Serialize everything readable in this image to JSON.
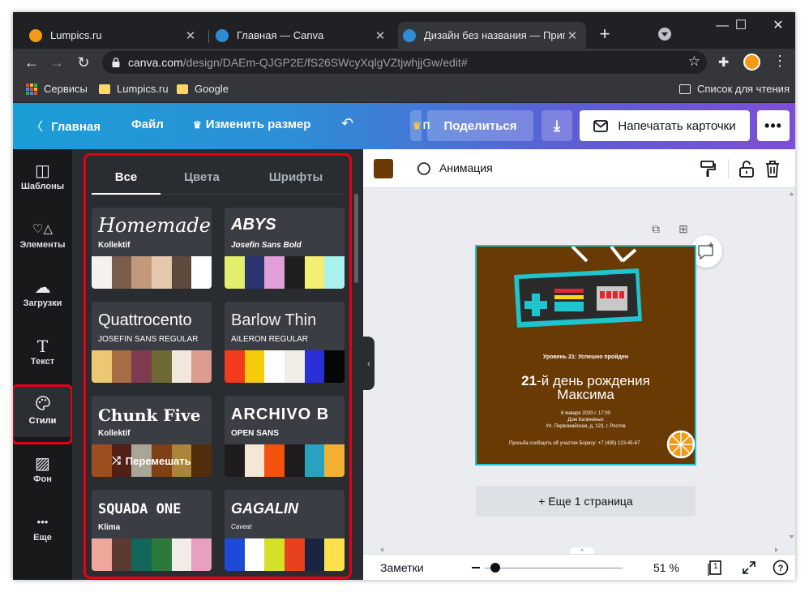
{
  "browser": {
    "tabs": [
      {
        "title": "Lumpics.ru",
        "favicon": "orange-favicon"
      },
      {
        "title": "Главная — Canva",
        "favicon": "canva-favicon"
      },
      {
        "title": "Дизайн без названия — Пригл",
        "favicon": "canva-favicon"
      }
    ],
    "url_domain": "canva.com",
    "url_path": "/design/DAEm-QJGP2E/fS26SWcyXqlgVZtjwhjjGw/edit#",
    "bookmarks": [
      {
        "label": "Сервисы",
        "icon": "apps-grid-icon"
      },
      {
        "label": "Lumpics.ru",
        "icon": "folder-icon"
      },
      {
        "label": "Google",
        "icon": "folder-icon"
      }
    ],
    "reading_list": "Список для чтения"
  },
  "header": {
    "home": "Главная",
    "file": "Файл",
    "resize": "Изменить размер",
    "crown_stub": "П",
    "share": "Поделиться",
    "print": "Напечатать карточки",
    "more": "•••"
  },
  "rail": [
    {
      "label": "Шаблоны",
      "icon": "templates-icon",
      "glyph": "◫"
    },
    {
      "label": "Элементы",
      "icon": "elements-icon",
      "glyph": "♡△"
    },
    {
      "label": "Загрузки",
      "icon": "upload-cloud-icon",
      "glyph": "☁"
    },
    {
      "label": "Текст",
      "icon": "text-icon",
      "glyph": "T"
    },
    {
      "label": "Стили",
      "icon": "palette-icon",
      "glyph": "🎨"
    },
    {
      "label": "Фон",
      "icon": "background-hatch-icon",
      "glyph": "▨"
    },
    {
      "label": "Еще",
      "icon": "more-dots-icon",
      "glyph": "•••"
    }
  ],
  "panel": {
    "tabs": [
      "Все",
      "Цвета",
      "Шрифты"
    ],
    "active_tab": "Все",
    "shuffle_label": "Перемешать",
    "styles": [
      {
        "heading": "Homemade a",
        "body": "Kollektif",
        "colors": [
          "#f5f1ec",
          "#7a5d4a",
          "#c29a7b",
          "#e4c9ad",
          "#5e4a3c",
          "#ffffff"
        ]
      },
      {
        "heading": "ABYS",
        "body": "Josefin Sans Bold",
        "colors": [
          "#e2ee6c",
          "#2b3570",
          "#e19fd8",
          "#1f1f1f",
          "#f4ee73",
          "#a9f1ec"
        ]
      },
      {
        "heading": "Quattrocento",
        "body": "JOSEFIN SANS REGULAR",
        "colors": [
          "#ecc874",
          "#a76d43",
          "#7e3c4f",
          "#6f6a33",
          "#f1e8dd",
          "#dc9c8f"
        ]
      },
      {
        "heading": "Barlow Thin",
        "body": "AILERON REGULAR",
        "colors": [
          "#f23b1d",
          "#f6cb0c",
          "#fdfdfd",
          "#f1eee7",
          "#2a2fd8",
          "#060606"
        ]
      },
      {
        "heading": "Chunk Five",
        "body": "Kollektif",
        "colors": [
          "#d2692a",
          "#6d2b1e",
          "#e5dcc7",
          "#a8561d",
          "#e4b04f",
          "#6d3c12"
        ]
      },
      {
        "heading": "ARCHIVO B",
        "body": "OPEN SANS",
        "colors": [
          "#1e1c1d",
          "#f6e6d6",
          "#f3520d",
          "#1d1b1b",
          "#28a2be",
          "#f4b032"
        ]
      },
      {
        "heading": "SQUADA ONE",
        "body": "Klima",
        "colors": [
          "#f0a79b",
          "#5a3a33",
          "#12665a",
          "#2b7a3b",
          "#f0ece7",
          "#e99fc0"
        ]
      },
      {
        "heading": "GAGALIN",
        "body": "Caveat",
        "colors": [
          "#1d4bd8",
          "#fefefe",
          "#d5e028",
          "#e8411f",
          "#1b2442",
          "#fde04c"
        ]
      }
    ]
  },
  "editor": {
    "color_chip": "#6b3a05",
    "animation": "Анимация",
    "design": {
      "level": "Уровень 21: Успешно пройден",
      "title_bold": "21",
      "title_rest": "-й день рождения",
      "name": "Максима",
      "date": "6 января 2020 г. 17:00",
      "place": "Дом Калининых",
      "address": "Ул. Первомайская, д. 123, г. Ростов",
      "rsvp": "Просьба сообщить об участии Борису: +7 (495) 123-45-67"
    },
    "add_page": "+ Еще 1 страница",
    "notes": "Заметки",
    "zoom": "51 %",
    "zoom_level": 0.04,
    "page_count": "1"
  }
}
